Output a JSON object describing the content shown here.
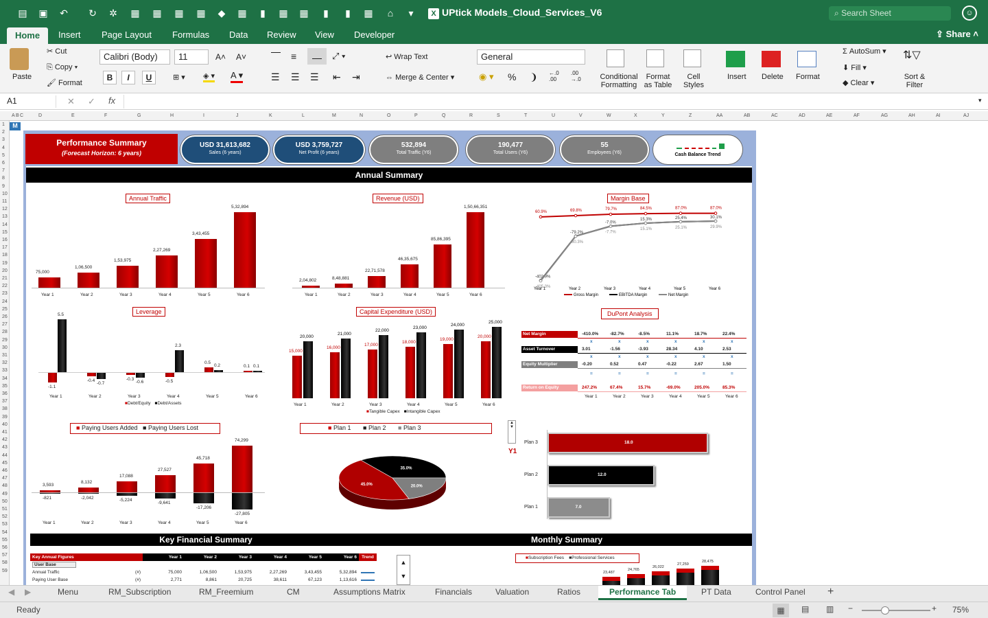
{
  "app": {
    "title": "UPtick Models_Cloud_Services_V6",
    "search_placeholder": "Search Sheet",
    "share": "Share"
  },
  "ribbon_tabs": [
    "Home",
    "Insert",
    "Page Layout",
    "Formulas",
    "Data",
    "Review",
    "View",
    "Developer"
  ],
  "ribbon": {
    "paste": "Paste",
    "cut": "Cut",
    "copy": "Copy",
    "format": "Format",
    "font": "Calibri (Body)",
    "size": "11",
    "wrap": "Wrap Text",
    "merge": "Merge & Center",
    "number_format": "General",
    "cond": "Conditional Formatting",
    "fmt_table": "Format as Table",
    "cell_styles": "Cell Styles",
    "insert": "Insert",
    "delete": "Delete",
    "format2": "Format",
    "autosum": "AutoSum",
    "fill": "Fill",
    "clear": "Clear",
    "sort": "Sort & Filter"
  },
  "formula_bar": {
    "cell": "A1",
    "fx": "fx"
  },
  "kpis": [
    {
      "value": "Performance Summary",
      "label": "(Forecast Horizon: 6 years)",
      "color": "#c00000"
    },
    {
      "value": "USD 31,613,682",
      "label": "Sales (6 years)",
      "color": "#1f4e79"
    },
    {
      "value": "USD 3,759,727",
      "label": "Net Profit (6 years)",
      "color": "#1f4e79"
    },
    {
      "value": "532,894",
      "label": "Total Traffic (Y6)",
      "color": "#7f7f7f"
    },
    {
      "value": "190,477",
      "label": "Total Users (Y6)",
      "color": "#7f7f7f"
    },
    {
      "value": "55",
      "label": "Employees (Y6)",
      "color": "#7f7f7f"
    },
    {
      "value": "",
      "label": "Cash Balance Trend",
      "color": "#ffffff"
    }
  ],
  "sections": {
    "annual": "Annual Summary",
    "key_fin": "Key Financial Summary",
    "monthly": "Monthly Summary"
  },
  "chart_titles": {
    "traffic": "Annual Traffic",
    "revenue": "Revenue (USD)",
    "margin": "Margin Base",
    "leverage": "Leverage",
    "capex": "Capital Expenditure (USD)",
    "dupont": "DuPont Analysis"
  },
  "years": [
    "Year 1",
    "Year 2",
    "Year 3",
    "Year 4",
    "Year 5",
    "Year 6"
  ],
  "chart_data": [
    {
      "type": "bar",
      "title": "Annual Traffic",
      "categories": [
        "Year 1",
        "Year 2",
        "Year 3",
        "Year 4",
        "Year 5",
        "Year 6"
      ],
      "values": [
        75000,
        106500,
        153975,
        227269,
        343455,
        532894
      ],
      "labels": [
        "75,000",
        "1,06,500",
        "1,53,975",
        "2,27,269",
        "3,43,455",
        "5,32,894"
      ]
    },
    {
      "type": "bar",
      "title": "Revenue (USD)",
      "categories": [
        "Year 1",
        "Year 2",
        "Year 3",
        "Year 4",
        "Year 5",
        "Year 6"
      ],
      "values": [
        204802,
        848881,
        2271578,
        4635675,
        8586395,
        15066351
      ],
      "labels": [
        "2,04,802",
        "8,48,881",
        "22,71,578",
        "46,35,675",
        "85,86,395",
        "1,50,66,351"
      ]
    },
    {
      "type": "line",
      "title": "Margin Base",
      "categories": [
        "Year 1",
        "Year 2",
        "Year 3",
        "Year 4",
        "Year 5",
        "Year 6"
      ],
      "series": [
        {
          "name": "Gross Margin",
          "values": [
            60.9,
            69.8,
            79.7,
            84.5,
            87.0,
            87.0
          ]
        },
        {
          "name": "EBITDA Margin",
          "values": [
            -402.9,
            -79.2,
            -7.0,
            15.3,
            25.4,
            30.1
          ]
        },
        {
          "name": "Net Margin",
          "values": [
            -405.3,
            -80.3,
            -7.7,
            15.1,
            25.1,
            29.9
          ]
        }
      ]
    },
    {
      "type": "bar",
      "title": "Leverage",
      "categories": [
        "Year 1",
        "Year 2",
        "Year 3",
        "Year 4",
        "Year 5",
        "Year 6"
      ],
      "series": [
        {
          "name": "Debt/Equity",
          "values": [
            -1.1,
            -0.4,
            -0.3,
            -0.5,
            0.5,
            0.1
          ]
        },
        {
          "name": "Debt/Assets",
          "values": [
            5.5,
            -0.7,
            -0.6,
            2.3,
            0.2,
            0.1
          ]
        }
      ]
    },
    {
      "type": "bar",
      "title": "Capital Expenditure (USD)",
      "categories": [
        "Year 1",
        "Year 2",
        "Year 3",
        "Year 4",
        "Year 5",
        "Year 6"
      ],
      "series": [
        {
          "name": "Tangible Capex",
          "values": [
            15000,
            16000,
            17000,
            18000,
            19000,
            20000
          ]
        },
        {
          "name": "Intangible Capex",
          "values": [
            20000,
            21000,
            22000,
            23000,
            24000,
            25000
          ]
        }
      ]
    },
    {
      "type": "bar",
      "categories": [
        "Year 1",
        "Year 2",
        "Year 3",
        "Year 4",
        "Year 5",
        "Year 6"
      ],
      "series": [
        {
          "name": "Paying Users Added",
          "values": [
            3593,
            8132,
            17088,
            27527,
            45718,
            74299
          ]
        },
        {
          "name": "Paying Users Lost",
          "values": [
            -821,
            -2042,
            -5224,
            -9641,
            -17206,
            -27805
          ]
        }
      ]
    },
    {
      "type": "pie",
      "categories": [
        "Plan 1",
        "Plan 2",
        "Plan 3"
      ],
      "values": [
        45.0,
        35.0,
        20.0
      ]
    },
    {
      "type": "bar",
      "categories": [
        "Plan 1",
        "Plan 2",
        "Plan 3"
      ],
      "values": [
        7.0,
        12.0,
        18.0
      ],
      "label": "Y1"
    }
  ],
  "dupont": {
    "rows": [
      {
        "label": "Net Margin",
        "values": [
          "-410.0%",
          "-82.7%",
          "-8.5%",
          "11.1%",
          "18.7%",
          "22.4%"
        ]
      },
      {
        "label": "Asset Turnover",
        "values": [
          "3.01",
          "-1.56",
          "-3.93",
          "28.34",
          "4.10",
          "2.53"
        ]
      },
      {
        "label": "Equity Multiplier",
        "values": [
          "-0.20",
          "0.52",
          "0.47",
          "-0.22",
          "2.67",
          "1.50"
        ]
      },
      {
        "label": "Return on Equity",
        "values": [
          "247.2%",
          "67.4%",
          "15.7%",
          "-69.0%",
          "205.0%",
          "85.3%"
        ]
      }
    ],
    "ops": [
      "x",
      "x",
      "="
    ]
  },
  "key_table": {
    "header": [
      "Key Annual Figures",
      "Year 1",
      "Year 2",
      "Year 3",
      "Year 4",
      "Year 5",
      "Year 6",
      "Trend"
    ],
    "section": "User Base",
    "rows": [
      {
        "label": "Annual Traffic",
        "unit": "(#)",
        "values": [
          "75,000",
          "1,06,500",
          "1,53,975",
          "2,27,269",
          "3,43,455",
          "5,32,894"
        ]
      },
      {
        "label": "Paying User Base",
        "unit": "(#)",
        "values": [
          "2,771",
          "8,861",
          "20,725",
          "38,611",
          "67,123",
          "1,13,616"
        ]
      }
    ]
  },
  "monthly": {
    "legend": [
      "Subscription Fees",
      "Professional Services"
    ],
    "labels": [
      "23,487",
      "24,765",
      "26,022",
      "27,259",
      "28,475"
    ]
  },
  "legend_plans": [
    "Plan 1",
    "Plan 2",
    "Plan 3"
  ],
  "legend_users": [
    "Paying Users Added",
    "Paying Users Lost"
  ],
  "sheet_tabs": [
    "Menu",
    "RM_Subscription",
    "RM_Freemium",
    "CM",
    "Assumptions Matrix",
    "Financials",
    "Valuation",
    "Ratios",
    "Performance Tab",
    "PT Data",
    "Control Panel"
  ],
  "status": {
    "ready": "Ready",
    "zoom": "75%"
  }
}
